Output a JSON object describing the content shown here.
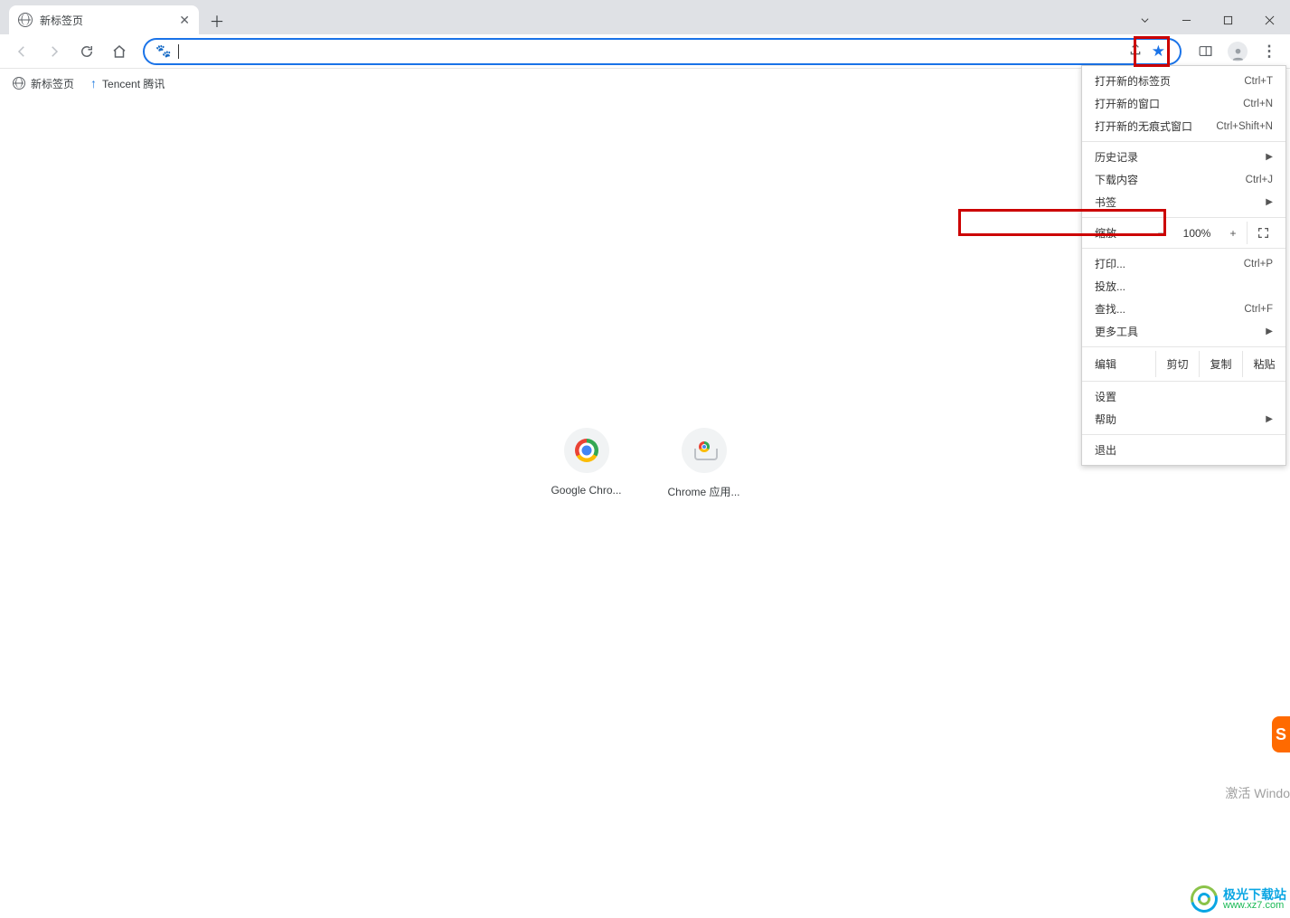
{
  "tab": {
    "title": "新标签页"
  },
  "bookmarks": [
    {
      "label": "新标签页"
    },
    {
      "label": "Tencent 腾讯"
    }
  ],
  "shortcuts": [
    {
      "label": "Google Chro..."
    },
    {
      "label": "Chrome 应用..."
    }
  ],
  "menu": {
    "new_tab": {
      "label": "打开新的标签页",
      "kb": "Ctrl+T"
    },
    "new_window": {
      "label": "打开新的窗口",
      "kb": "Ctrl+N"
    },
    "incognito": {
      "label": "打开新的无痕式窗口",
      "kb": "Ctrl+Shift+N"
    },
    "history": {
      "label": "历史记录"
    },
    "downloads": {
      "label": "下载内容",
      "kb": "Ctrl+J"
    },
    "bookmarks": {
      "label": "书签"
    },
    "zoom": {
      "label": "缩放",
      "minus": "−",
      "value": "100%",
      "plus": "+"
    },
    "print": {
      "label": "打印...",
      "kb": "Ctrl+P"
    },
    "cast": {
      "label": "投放..."
    },
    "find": {
      "label": "查找...",
      "kb": "Ctrl+F"
    },
    "more_tools": {
      "label": "更多工具"
    },
    "edit": {
      "label": "编辑",
      "cut": "剪切",
      "copy": "复制",
      "paste": "粘贴"
    },
    "settings": {
      "label": "设置"
    },
    "help": {
      "label": "帮助"
    },
    "exit": {
      "label": "退出"
    }
  },
  "watermark": {
    "activate": "激活 Windo",
    "brand": "极光下载站",
    "url": "www.xz7.com"
  }
}
